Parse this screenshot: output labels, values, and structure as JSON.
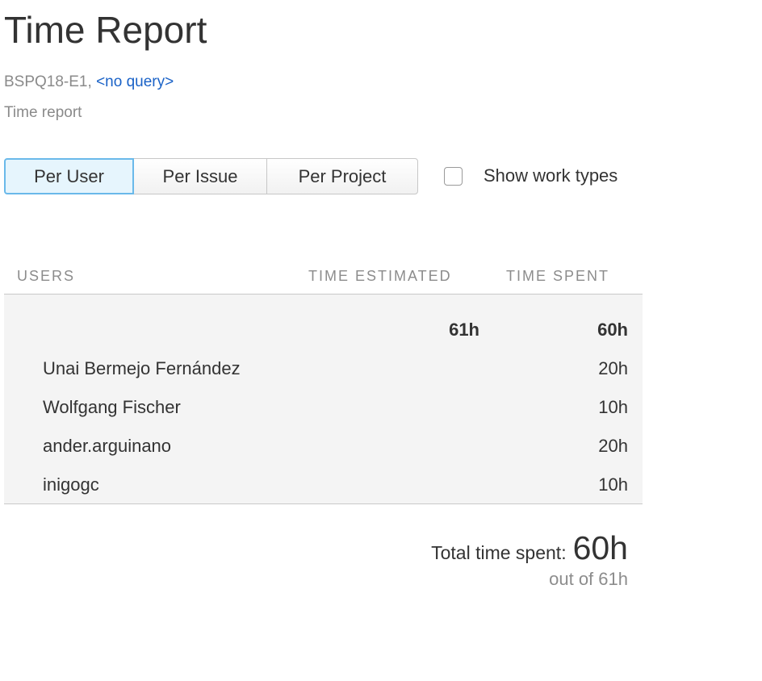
{
  "page": {
    "title": "Time Report",
    "subtitle_prefix": "BSPQ18-E1,",
    "query_link": "<no query>",
    "description": "Time report"
  },
  "tabs": [
    {
      "label": "Per User",
      "active": true
    },
    {
      "label": "Per Issue",
      "active": false
    },
    {
      "label": "Per Project",
      "active": false
    }
  ],
  "options": {
    "show_work_types_label": "Show work types",
    "show_work_types_checked": false
  },
  "table": {
    "columns": [
      "USERS",
      "TIME ESTIMATED",
      "TIME SPENT"
    ],
    "total_row": {
      "name": "",
      "estimated": "61h",
      "spent": "60h"
    },
    "rows": [
      {
        "name": "Unai Bermejo Fernández",
        "estimated": "",
        "spent": "20h"
      },
      {
        "name": "Wolfgang Fischer",
        "estimated": "",
        "spent": "10h"
      },
      {
        "name": "ander.arguinano",
        "estimated": "",
        "spent": "20h"
      },
      {
        "name": "inigogc",
        "estimated": "",
        "spent": "10h"
      }
    ]
  },
  "summary": {
    "label": "Total time spent:",
    "value": "60h",
    "out_of": "out of 61h"
  },
  "colors": {
    "link": "#1a62c7",
    "active_tab_border": "#6ab9ea",
    "active_tab_bg": "#e6f5fd",
    "table_bg": "#f4f4f4"
  }
}
